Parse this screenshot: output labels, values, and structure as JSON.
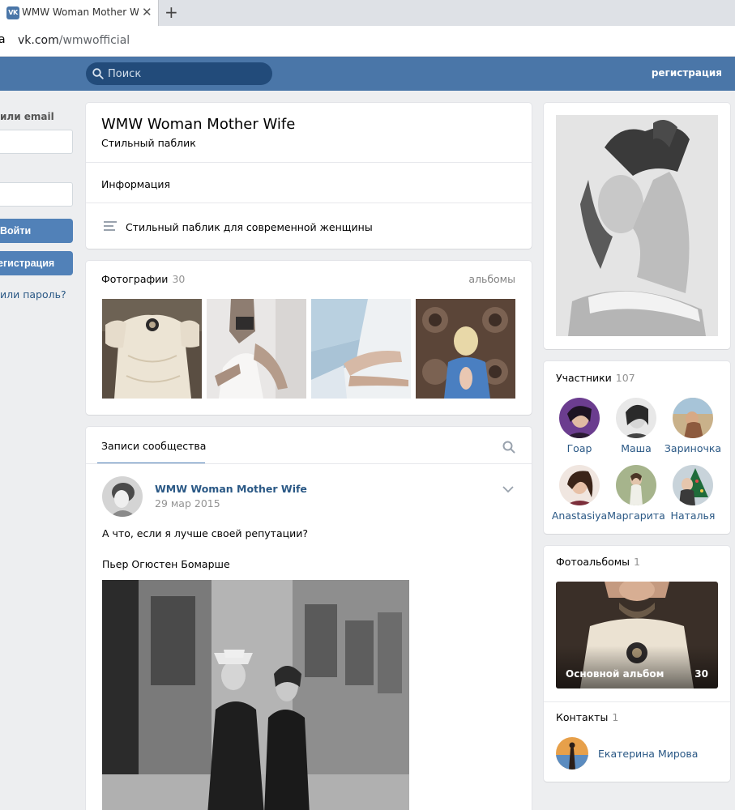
{
  "browser": {
    "tab_title": "WMW Woman Mother Wife",
    "tab_close": "✕",
    "new_tab": "+",
    "addr_left_fragment": "a",
    "url_host": "vk.com",
    "url_path": "/wmwofficial"
  },
  "header": {
    "search_placeholder": "Поиск",
    "register_link": "регистрация",
    "brand_color": "#4a76a8"
  },
  "login": {
    "email_label": "или email",
    "login_button": "Войти",
    "register_button": "Регистрация",
    "forgot_link": "или пароль?"
  },
  "group": {
    "name": "WMW Woman Mother Wife",
    "subtitle": "Стильный паблик",
    "info_tab": "Информация",
    "description": "Стильный паблик для современной женщины"
  },
  "photos": {
    "title": "Фотографии",
    "count": "30",
    "albums_link": "альбомы"
  },
  "wall": {
    "tab": "Записи сообщества",
    "post": {
      "author": "WMW Woman Mother Wife",
      "date": "29 мар 2015",
      "line1": "А что, если я лучше своей репутации?",
      "line2": "Пьер Огюстен Бомарше"
    }
  },
  "members": {
    "title": "Участники",
    "count": "107",
    "items": [
      {
        "name": "Гоар"
      },
      {
        "name": "Маша"
      },
      {
        "name": "Зариночка"
      },
      {
        "name": "Anastasiya"
      },
      {
        "name": "Маргарита"
      },
      {
        "name": "Наталья"
      }
    ]
  },
  "albums": {
    "title": "Фотоальбомы",
    "count": "1",
    "main_album": "Основной альбом",
    "main_album_count": "30"
  },
  "contacts": {
    "title": "Контакты",
    "count": "1",
    "name": "Екатерина Мирова"
  }
}
